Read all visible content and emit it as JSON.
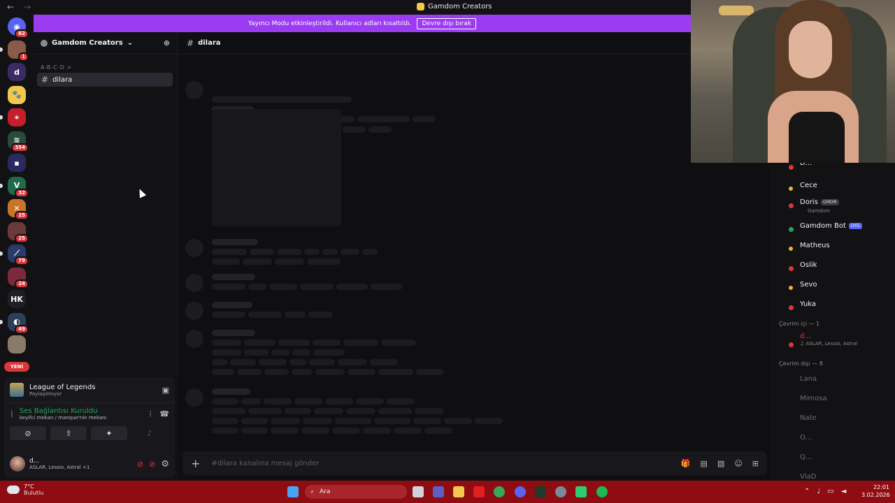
{
  "window": {
    "title": "Gamdom Creators",
    "back_glyph": "←",
    "forward_glyph": "→"
  },
  "banner": {
    "text": "Yayıncı Modu etkinleştirildi. Kullanıcı adları kısaltıldı.",
    "button": "Devre dışı bırak",
    "color": "#9b3bf2"
  },
  "servers": [
    {
      "name": "discord-home",
      "glyph": "◉",
      "badge": "62",
      "color": "#5865f2"
    },
    {
      "name": "server-avatar-1",
      "glyph": "",
      "badge": "1",
      "color": "#8a5a4a"
    },
    {
      "name": "server-d",
      "glyph": "d",
      "badge": "",
      "color": "#3a2a66"
    },
    {
      "name": "server-paw",
      "glyph": "🐾",
      "badge": "",
      "color": "#f2c84b"
    },
    {
      "name": "server-red",
      "glyph": "✶",
      "badge": "",
      "color": "#c41f2a"
    },
    {
      "name": "server-green",
      "glyph": "≋",
      "badge": "354",
      "color": "#2a4a3a"
    },
    {
      "name": "server-folder",
      "glyph": "▪",
      "badge": "",
      "color": "#2a2a60"
    },
    {
      "name": "server-valorant",
      "glyph": "V",
      "badge": "32",
      "color": "#1f6a4a"
    },
    {
      "name": "server-cross",
      "glyph": "✕",
      "badge": "25",
      "color": "#c8752a"
    },
    {
      "name": "server-avatar-2",
      "glyph": "",
      "badge": "25",
      "color": "#6a3a3a"
    },
    {
      "name": "server-lol",
      "glyph": "⟋",
      "badge": "79",
      "color": "#2a3a6a"
    },
    {
      "name": "server-avatar-3",
      "glyph": "",
      "badge": "24",
      "color": "#7a2a3a"
    },
    {
      "name": "server-hk",
      "glyph": "HK",
      "badge": "",
      "color": "#1f1f24"
    },
    {
      "name": "server-swirl",
      "glyph": "◐",
      "badge": "49",
      "color": "#2a3f5a"
    },
    {
      "name": "server-stone",
      "glyph": "",
      "badge": "",
      "color": "#8a7a6a"
    }
  ],
  "rail_new": "YENİ",
  "guild": {
    "name": "Gamdom Creators",
    "chevron": "⌄",
    "add_glyph": "⊕"
  },
  "category": "A-B-C-D",
  "category_chevron": ">",
  "channel": {
    "hash": "#",
    "name": "dilara"
  },
  "activity": {
    "title": "League of Legends",
    "status": "Paylaşılmıyor"
  },
  "voice": {
    "title": "Ses Bağlantısı Kuruldu",
    "detail": "keyifci mekan / manque'nin mekanı"
  },
  "user": {
    "name": "d...",
    "activity": "ASLAR, Lessio, Astral +1"
  },
  "composer": {
    "plus": "+",
    "placeholder": "#dilara kanalına mesaj gönder"
  },
  "members": {
    "cut_top": "D...",
    "list": [
      {
        "name": "Cece",
        "status": "idle",
        "tag": "",
        "sub": ""
      },
      {
        "name": "Doris",
        "status": "dnd",
        "tag": "GMDM",
        "sub": "Gamdom"
      },
      {
        "name": "Gamdom Bot",
        "status": "online",
        "tag": "UYG",
        "sub": ""
      },
      {
        "name": "Matheus",
        "status": "idle",
        "tag": "",
        "sub": ""
      },
      {
        "name": "Oslik",
        "status": "dnd",
        "tag": "",
        "sub": ""
      },
      {
        "name": "Sevo",
        "status": "idle",
        "tag": "",
        "sub": ""
      },
      {
        "name": "Yuka",
        "status": "dnd",
        "tag": "",
        "sub": ""
      }
    ],
    "online_header": "Çevrim içi — 1",
    "online_user": {
      "name": "d...",
      "sub": "♫ ASLAR, Lessio, Astral"
    },
    "offline_header": "Çevrim dışı — 8",
    "offline": [
      "Lana",
      "Mimosa",
      "Nate",
      "O...",
      "Q...",
      "VlaD"
    ]
  },
  "taskbar": {
    "temp": "7°C",
    "weather": "Bulutlu",
    "search": "Ara",
    "time": "22:01",
    "date": "3.02.2026",
    "color": "#8e0c12"
  }
}
